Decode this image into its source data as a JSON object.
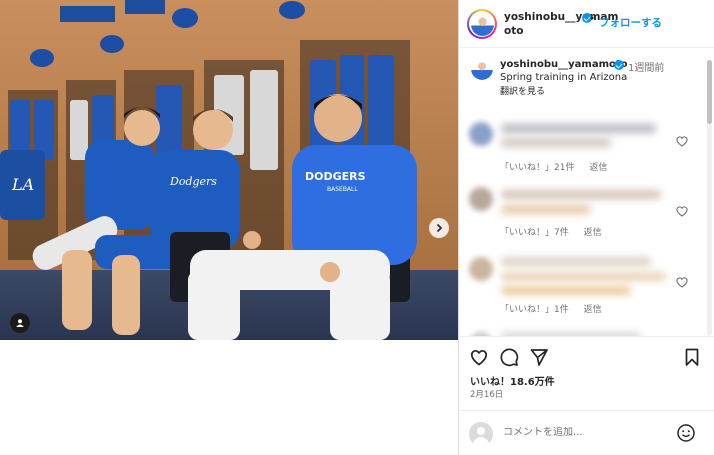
{
  "post": {
    "username": "yoshinobu__yamamoto",
    "follow_label": "フォローする",
    "separator": "•",
    "caption_text": "Spring training in Arizona",
    "caption_time": "1週間前",
    "translate_label": "翻訳を見る",
    "likes_label": "いいね！18.6万件",
    "date_label": "2月16日"
  },
  "comments": [
    {
      "likes": "「いいね！」21件",
      "reply": "返信"
    },
    {
      "likes": "「いいね！」7件",
      "reply": "返信"
    },
    {
      "likes": "「いいね！」1件",
      "reply": "返信"
    }
  ],
  "comment_box": {
    "placeholder": "コメントを追加..."
  },
  "photo": {
    "jersey_text": "DODGERS",
    "jersey_subtext": "BASEBALL",
    "shirt_text": "Dodgers",
    "logo_text": "LA"
  },
  "colors": {
    "accent": "#0095f6",
    "dodger_blue": "#1e5bb8",
    "text": "#262626",
    "muted": "#737373"
  }
}
